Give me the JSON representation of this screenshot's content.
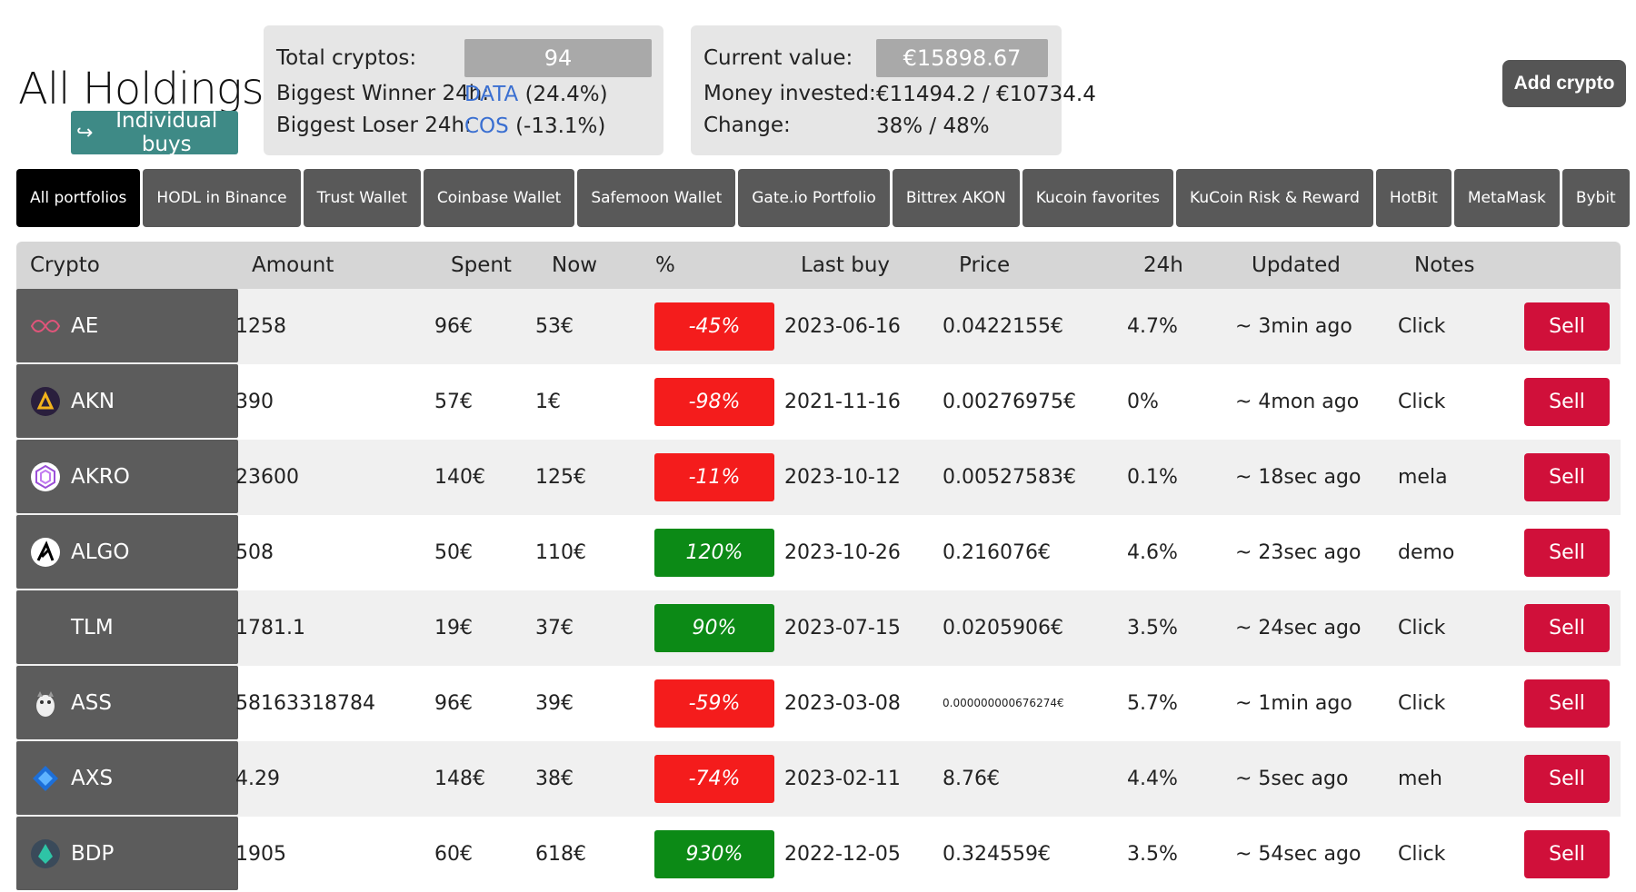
{
  "page": {
    "title": "All Holdings",
    "individual_buys_label": "Individual buys",
    "add_crypto_label": "Add crypto"
  },
  "summary": {
    "total_cryptos_label": "Total cryptos:",
    "total_cryptos": "94",
    "biggest_winner_label": "Biggest Winner 24h:",
    "biggest_winner_symbol": "DATA",
    "biggest_winner_change": " (24.4%)",
    "biggest_loser_label": "Biggest Loser 24h:",
    "biggest_loser_symbol": "COS",
    "biggest_loser_change": " (-13.1%)"
  },
  "value": {
    "current_value_label": "Current value:",
    "current_value": "€15898.67",
    "money_invested_label": "Money invested:",
    "money_invested": "€11494.2 / €10734.4",
    "change_label": "Change:",
    "change": "38% / 48%"
  },
  "tabs": [
    {
      "label": "All portfolios",
      "active": true
    },
    {
      "label": "HODL in Binance",
      "active": false
    },
    {
      "label": "Trust Wallet",
      "active": false
    },
    {
      "label": "Coinbase Wallet",
      "active": false
    },
    {
      "label": "Safemoon Wallet",
      "active": false
    },
    {
      "label": "Gate.io Portfolio",
      "active": false
    },
    {
      "label": "Bittrex AKON",
      "active": false
    },
    {
      "label": "Kucoin favorites",
      "active": false
    },
    {
      "label": "KuCoin Risk & Reward",
      "active": false
    },
    {
      "label": "HotBit",
      "active": false
    },
    {
      "label": "MetaMask",
      "active": false
    },
    {
      "label": "Bybit",
      "active": false
    }
  ],
  "table": {
    "headers": {
      "crypto": "Crypto",
      "amount": "Amount",
      "spent": "Spent",
      "now": "Now",
      "pct": "%",
      "last_buy": "Last buy",
      "price": "Price",
      "change24h": "24h",
      "updated": "Updated",
      "notes": "Notes"
    },
    "sell_label": "Sell",
    "rows": [
      {
        "symbol": "AE",
        "icon": "ae-logo-icon",
        "amount": "1258",
        "spent": "96€",
        "now": "53€",
        "pct": "-45%",
        "positive": false,
        "last_buy": "2023-06-16",
        "price": "0.0422155€",
        "change24h": "4.7%",
        "updated": "~ 3min ago",
        "notes": "Click"
      },
      {
        "symbol": "AKN",
        "icon": "akn-logo-icon",
        "amount": "390",
        "spent": "57€",
        "now": "1€",
        "pct": "-98%",
        "positive": false,
        "last_buy": "2021-11-16",
        "price": "0.00276975€",
        "change24h": "0%",
        "updated": "~ 4mon ago",
        "notes": "Click"
      },
      {
        "symbol": "AKRO",
        "icon": "akro-logo-icon",
        "amount": "23600",
        "spent": "140€",
        "now": "125€",
        "pct": "-11%",
        "positive": false,
        "last_buy": "2023-10-12",
        "price": "0.00527583€",
        "change24h": "0.1%",
        "updated": "~ 18sec ago",
        "notes": "mela"
      },
      {
        "symbol": "ALGO",
        "icon": "algo-logo-icon",
        "amount": "508",
        "spent": "50€",
        "now": "110€",
        "pct": "120%",
        "positive": true,
        "last_buy": "2023-10-26",
        "price": "0.216076€",
        "change24h": "4.6%",
        "updated": "~ 23sec ago",
        "notes": "demo"
      },
      {
        "symbol": "TLM",
        "icon": "tlm-logo-icon",
        "amount": "1781.1",
        "spent": "19€",
        "now": "37€",
        "pct": "90%",
        "positive": true,
        "last_buy": "2023-07-15",
        "price": "0.0205906€",
        "change24h": "3.5%",
        "updated": "~ 24sec ago",
        "notes": "Click"
      },
      {
        "symbol": "ASS",
        "icon": "ass-logo-icon",
        "amount": "58163318784",
        "spent": "96€",
        "now": "39€",
        "pct": "-59%",
        "positive": false,
        "last_buy": "2023-03-08",
        "price": "0.000000000676274€",
        "small_price": true,
        "change24h": "5.7%",
        "updated": "~ 1min ago",
        "notes": "Click"
      },
      {
        "symbol": "AXS",
        "icon": "axs-logo-icon",
        "amount": "4.29",
        "spent": "148€",
        "now": "38€",
        "pct": "-74%",
        "positive": false,
        "last_buy": "2023-02-11",
        "price": "8.76€",
        "change24h": "4.4%",
        "updated": "~ 5sec ago",
        "notes": "meh"
      },
      {
        "symbol": "BDP",
        "icon": "bdp-logo-icon",
        "amount": "1905",
        "spent": "60€",
        "now": "618€",
        "pct": "930%",
        "positive": true,
        "last_buy": "2022-12-05",
        "price": "0.324559€",
        "change24h": "3.5%",
        "updated": "~ 54sec ago",
        "notes": "Click"
      }
    ]
  }
}
